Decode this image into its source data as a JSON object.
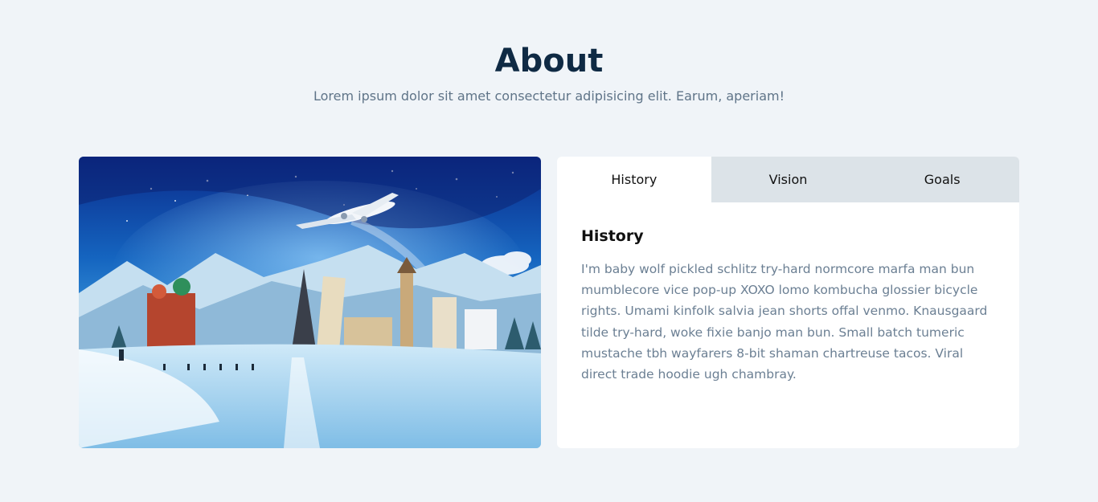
{
  "header": {
    "title": "About",
    "subtitle": "Lorem ipsum dolor sit amet consectetur adipisicing elit. Earum, aperiam!"
  },
  "image": {
    "alt": "travel landmarks winter collage",
    "sky_color": "#1565c0",
    "snow_color": "#e8f4fb"
  },
  "tabs": [
    {
      "label": "History",
      "active": true
    },
    {
      "label": "Vision",
      "active": false
    },
    {
      "label": "Goals",
      "active": false
    }
  ],
  "content": {
    "heading": "History",
    "body": "I'm baby wolf pickled schlitz try-hard normcore marfa man bun mumblecore vice pop-up XOXO lomo kombucha glossier bicycle rights. Umami kinfolk salvia jean shorts offal venmo. Knausgaard tilde try-hard, woke fixie banjo man bun. Small batch tumeric mustache tbh wayfarers 8-bit shaman chartreuse tacos. Viral direct trade hoodie ugh chambray."
  }
}
